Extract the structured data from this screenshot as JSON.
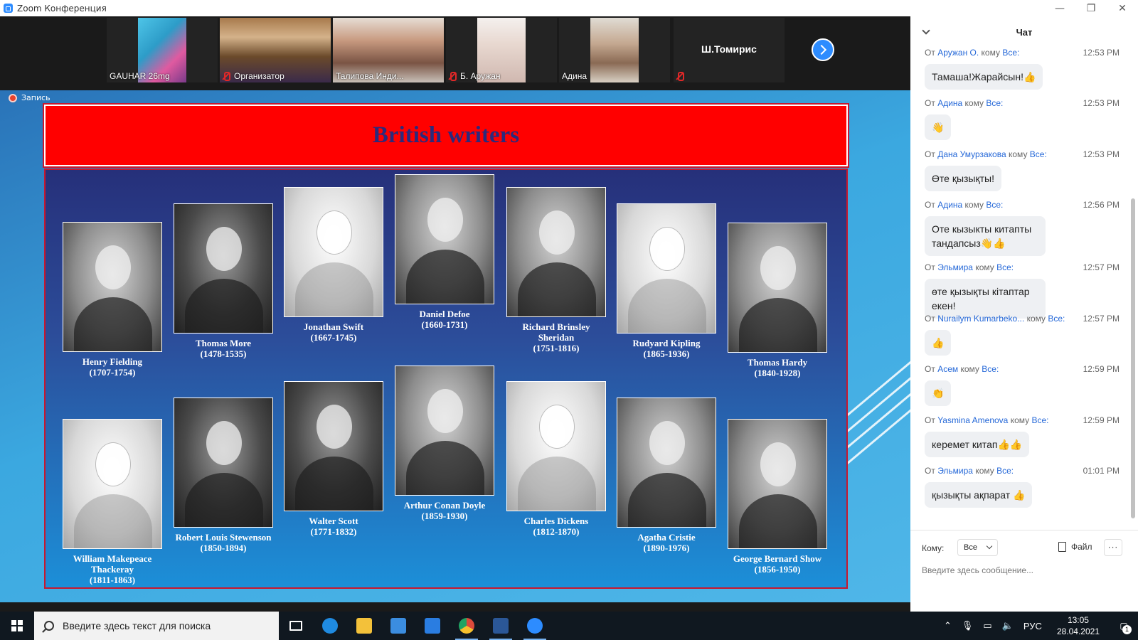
{
  "window": {
    "title": "Zoom Конференция",
    "controls": {
      "minimize": "—",
      "restore": "❐",
      "close": "✕"
    }
  },
  "participants": [
    {
      "name": "GAUHAR 26mg",
      "muted": false
    },
    {
      "name": "Организатор",
      "muted": true
    },
    {
      "name": "Талипова Инди...",
      "muted": false
    },
    {
      "name": "Б. Аружан",
      "muted": true
    },
    {
      "name": "Адина",
      "muted": false
    },
    {
      "name": "Ш.Томирис",
      "muted": true
    }
  ],
  "recording": {
    "label": "Запись"
  },
  "slide": {
    "title": "British writers",
    "writers": [
      {
        "name": "Henry Fielding",
        "years": "(1707-1754)"
      },
      {
        "name": "Thomas More",
        "years": "(1478-1535)"
      },
      {
        "name": "Jonathan Swift",
        "years": "(1667-1745)"
      },
      {
        "name": "Daniel Defoe",
        "years": "(1660-1731)"
      },
      {
        "name": "Richard Brinsley Sheridan",
        "years": "(1751-1816)"
      },
      {
        "name": "Rudyard Kipling",
        "years": "(1865-1936)"
      },
      {
        "name": "Thomas Hardy",
        "years": "(1840-1928)"
      },
      {
        "name": "William Makepeace Thackeray",
        "years": "(1811-1863)"
      },
      {
        "name": "Robert Louis Stewenson",
        "years": "(1850-1894)"
      },
      {
        "name": "Walter Scott",
        "years": "(1771-1832)"
      },
      {
        "name": "Arthur Conan Doyle",
        "years": "(1859-1930)"
      },
      {
        "name": "Charles Dickens",
        "years": "(1812-1870)"
      },
      {
        "name": "Agatha Cristie",
        "years": "(1890-1976)"
      },
      {
        "name": "George Bernard Show",
        "years": "(1856-1950)"
      }
    ]
  },
  "chat": {
    "title": "Чат",
    "from_label": "От",
    "to_word": "кому",
    "messages": [
      {
        "sender": "Аружан О.",
        "recipient": "Все:",
        "time": "12:53 PM",
        "text": "Тамаша!Жарайсын!👍"
      },
      {
        "sender": "Адина",
        "recipient": "Все:",
        "time": "12:53 PM",
        "text": "👋"
      },
      {
        "sender": "Дана Умурзакова",
        "recipient": "Все:",
        "time": "12:53 PM",
        "text": "Өте қызықты!"
      },
      {
        "sender": "Адина",
        "recipient": "Все:",
        "time": "12:56 PM",
        "text": "Оте кызыкты китапты тандапсыз👋👍"
      },
      {
        "sender": "Эльмира",
        "recipient": "Все:",
        "time": "12:57 PM",
        "text": "өте қызықты кітаптар екен!"
      },
      {
        "sender": "Nurailym Kumarbeko...",
        "recipient": "Все:",
        "time": "12:57 PM",
        "text": "👍"
      },
      {
        "sender": "Асем",
        "recipient": "Все:",
        "time": "12:59 PM",
        "text": "👏"
      },
      {
        "sender": "Yasmina Amenova",
        "recipient": "Все:",
        "time": "12:59 PM",
        "text": "керемет китап👍👍"
      },
      {
        "sender": "Эльмира",
        "recipient": "Все:",
        "time": "01:01 PM",
        "text": "қызықты ақпарат 👍"
      }
    ],
    "compose": {
      "to_label": "Кому:",
      "to_value": "Все",
      "file_label": "Файл",
      "more_label": "···",
      "placeholder": "Введите здесь сообщение..."
    }
  },
  "taskbar": {
    "search_placeholder": "Введите здесь текст для поиска",
    "apps": [
      {
        "name": "task-view",
        "color": "#ffffff"
      },
      {
        "name": "edge",
        "color": "#1f8ae0"
      },
      {
        "name": "explorer",
        "color": "#f3c13a"
      },
      {
        "name": "store",
        "color": "#3b8de0"
      },
      {
        "name": "mail",
        "color": "#2a7de1"
      },
      {
        "name": "chrome",
        "color": "#dd4a3b"
      },
      {
        "name": "word",
        "color": "#2b5797"
      },
      {
        "name": "zoom",
        "color": "#2d8cff"
      }
    ],
    "tray": {
      "language": "РУС"
    },
    "clock": {
      "time": "13:05",
      "date": "28.04.2021"
    },
    "notifications_count": "1"
  },
  "colors": {
    "accent": "#2d8cff",
    "slide_header": "#ff0000",
    "slide_title": "#2b2a7c",
    "chat_link": "#2568d8"
  }
}
